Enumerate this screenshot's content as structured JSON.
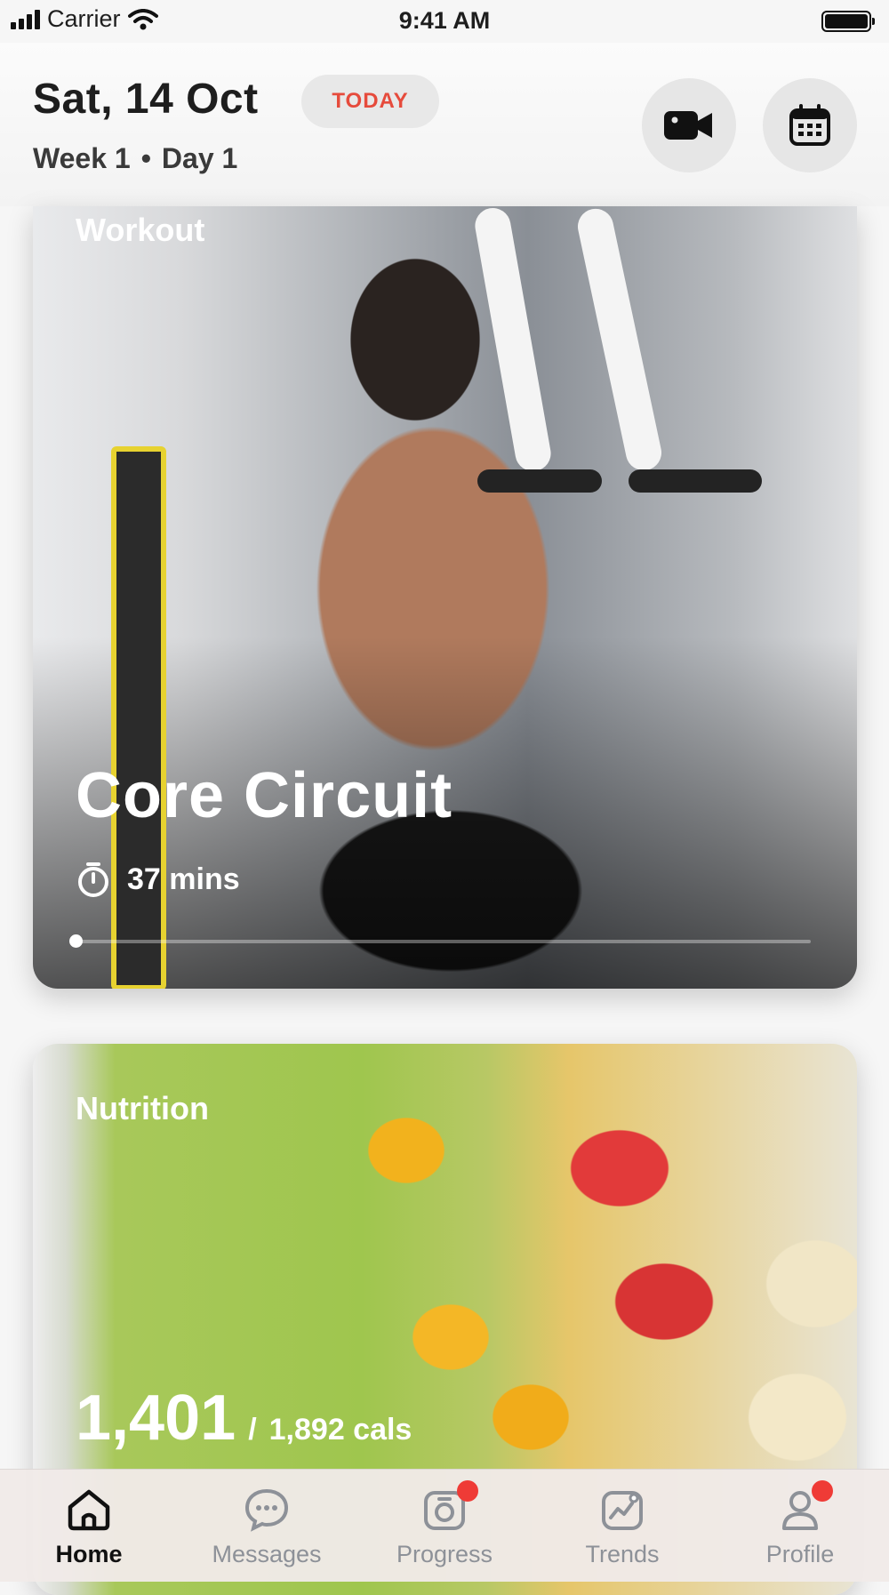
{
  "status_bar": {
    "carrier": "Carrier",
    "time": "9:41 AM"
  },
  "header": {
    "date": "Sat, 14 Oct",
    "today_badge": "TODAY",
    "week": "Week 1",
    "separator": "•",
    "day": "Day 1",
    "icons": [
      "video-camera-icon",
      "calendar-icon"
    ]
  },
  "workout": {
    "label": "Workout",
    "title": "Core Circuit",
    "duration": "37 mins",
    "progress": 0
  },
  "nutrition": {
    "label": "Nutrition",
    "consumed": "1,401",
    "separator": "/",
    "target": "1,892 cals"
  },
  "tabs": [
    {
      "label": "Home",
      "icon": "home-icon",
      "active": true,
      "badge": false
    },
    {
      "label": "Messages",
      "icon": "chat-bubble-icon",
      "active": false,
      "badge": false
    },
    {
      "label": "Progress",
      "icon": "camera-icon",
      "active": false,
      "badge": true
    },
    {
      "label": "Trends",
      "icon": "trend-chart-icon",
      "active": false,
      "badge": false
    },
    {
      "label": "Profile",
      "icon": "user-icon",
      "active": false,
      "badge": true
    }
  ],
  "colors": {
    "accent": "#e64b3c",
    "badge": "#ef3b36",
    "tab_inactive": "#8d9198"
  }
}
